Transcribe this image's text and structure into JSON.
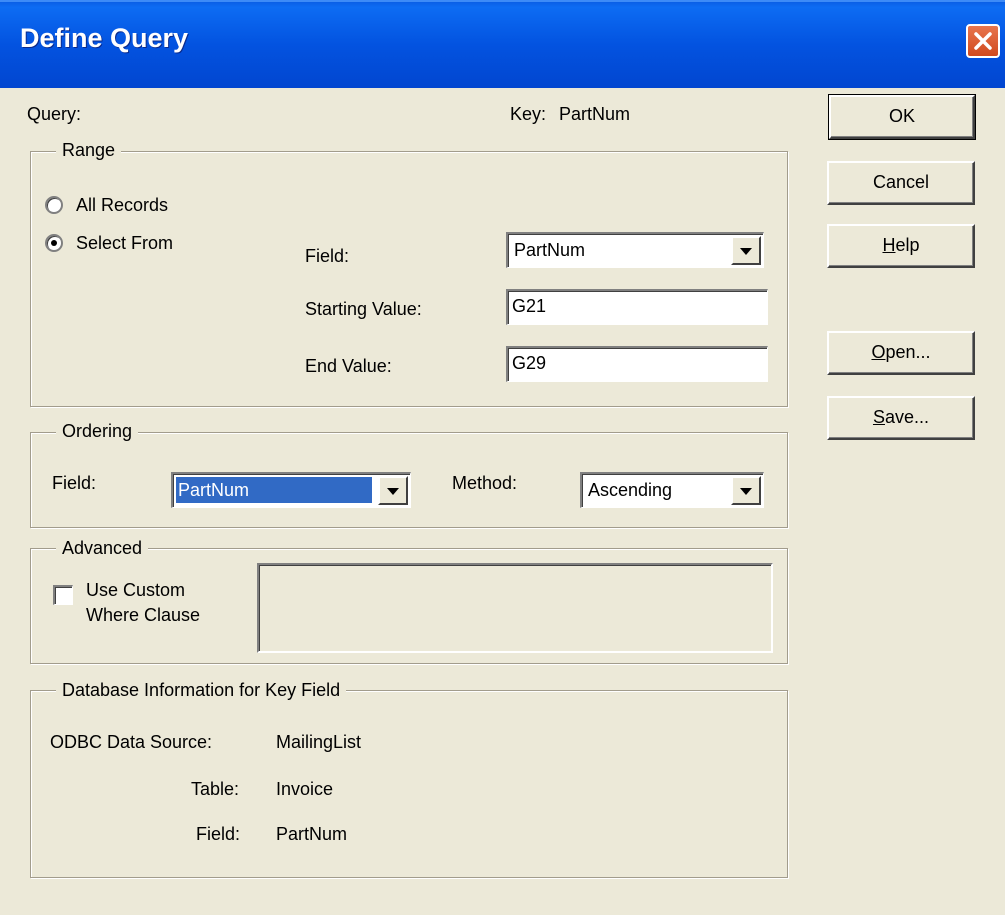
{
  "window": {
    "title": "Define Query"
  },
  "header": {
    "query_label": "Query:",
    "key_label": "Key:",
    "key_value": "PartNum"
  },
  "buttons": {
    "ok": "OK",
    "cancel": "Cancel",
    "help_mnemonic": "H",
    "help_rest": "elp",
    "open_mnemonic": "O",
    "open_rest": "pen...",
    "save_mnemonic": "S",
    "save_rest": "ave..."
  },
  "range": {
    "legend": "Range",
    "all_records": "All Records",
    "select_from": "Select From",
    "selected_option": "select_from",
    "field_label": "Field:",
    "field_value": "PartNum",
    "starting_label": "Starting Value:",
    "starting_value": "G21",
    "end_label": "End Value:",
    "end_value": "G29"
  },
  "ordering": {
    "legend": "Ordering",
    "field_label": "Field:",
    "field_value": "PartNum",
    "method_label": "Method:",
    "method_value": "Ascending"
  },
  "advanced": {
    "legend": "Advanced",
    "checkbox_line1": "Use Custom",
    "checkbox_line2": "Where Clause",
    "checked": false,
    "where_clause": ""
  },
  "dbinfo": {
    "legend": "Database Information for Key Field",
    "odbc_label": "ODBC Data Source:",
    "odbc_value": "MailingList",
    "table_label": "Table:",
    "table_value": "Invoice",
    "field_label": "Field:",
    "field_value": "PartNum"
  },
  "colors": {
    "titlebar": "#0353e0",
    "face": "#ece9d8",
    "selection": "#316ac5",
    "close": "#d14a1e"
  }
}
